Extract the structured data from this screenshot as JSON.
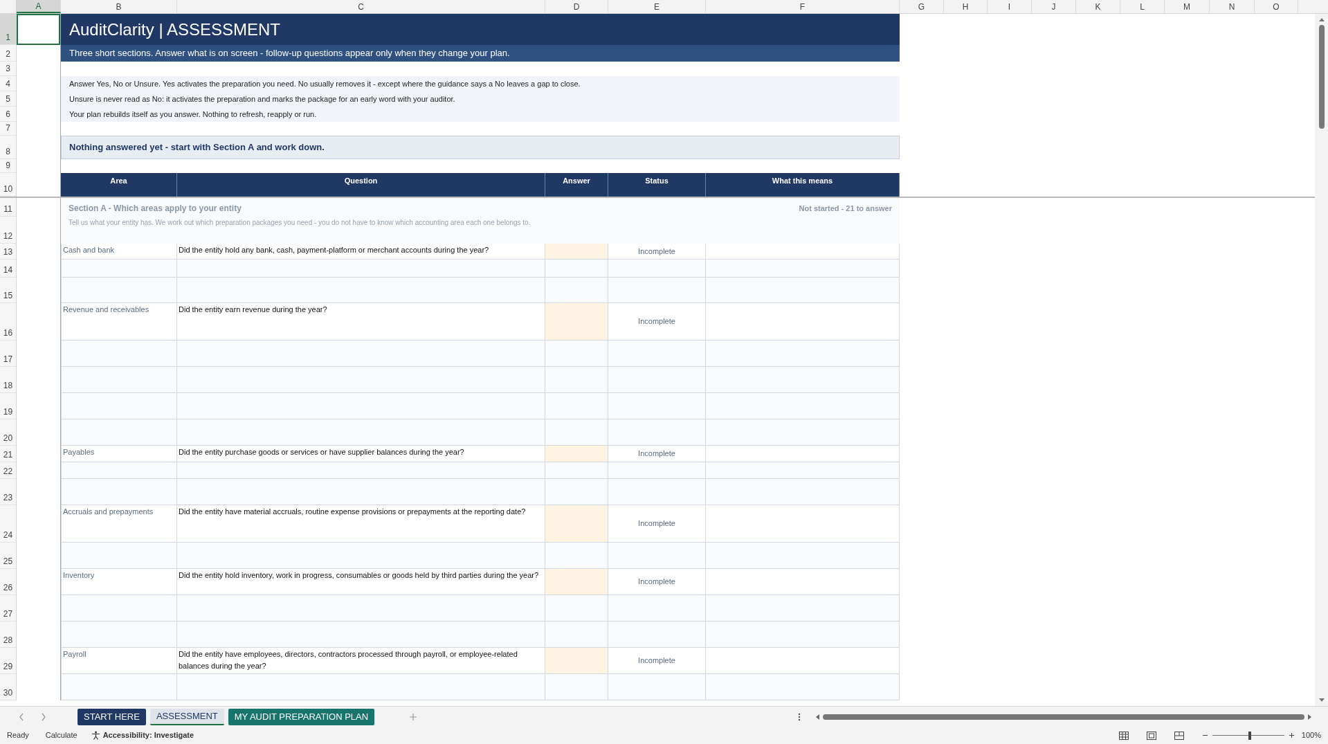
{
  "column_headers": [
    {
      "label": "A",
      "selected": true
    },
    {
      "label": "B",
      "selected": false
    },
    {
      "label": "C",
      "selected": false
    },
    {
      "label": "D",
      "selected": false
    },
    {
      "label": "E",
      "selected": false
    },
    {
      "label": "F",
      "selected": false
    },
    {
      "label": "G",
      "selected": false
    },
    {
      "label": "H",
      "selected": false
    },
    {
      "label": "I",
      "selected": false
    },
    {
      "label": "J",
      "selected": false
    },
    {
      "label": "K",
      "selected": false
    },
    {
      "label": "L",
      "selected": false
    },
    {
      "label": "M",
      "selected": false
    },
    {
      "label": "N",
      "selected": false
    },
    {
      "label": "O",
      "selected": false
    }
  ],
  "row_numbers": [
    {
      "label": "1",
      "selected": true
    },
    {
      "label": "2",
      "selected": false
    },
    {
      "label": "3",
      "selected": false
    },
    {
      "label": "4",
      "selected": false
    },
    {
      "label": "5",
      "selected": false
    },
    {
      "label": "6",
      "selected": false
    },
    {
      "label": "7",
      "selected": false
    },
    {
      "label": "8",
      "selected": false
    },
    {
      "label": "9",
      "selected": false
    },
    {
      "label": "10",
      "selected": false
    },
    {
      "label": "11",
      "selected": false
    },
    {
      "label": "12",
      "selected": false
    },
    {
      "label": "13",
      "selected": false
    },
    {
      "label": "14",
      "selected": false
    },
    {
      "label": "15",
      "selected": false
    },
    {
      "label": "16",
      "selected": false
    },
    {
      "label": "17",
      "selected": false
    },
    {
      "label": "18",
      "selected": false
    },
    {
      "label": "19",
      "selected": false
    },
    {
      "label": "20",
      "selected": false
    },
    {
      "label": "21",
      "selected": false
    },
    {
      "label": "22",
      "selected": false
    },
    {
      "label": "23",
      "selected": false
    },
    {
      "label": "24",
      "selected": false
    },
    {
      "label": "25",
      "selected": false
    },
    {
      "label": "26",
      "selected": false
    },
    {
      "label": "27",
      "selected": false
    },
    {
      "label": "28",
      "selected": false
    },
    {
      "label": "29",
      "selected": false
    },
    {
      "label": "30",
      "selected": false
    }
  ],
  "title": "AuditClarity | ASSESSMENT",
  "subtitle": "Three short sections. Answer what is on screen - follow-up questions appear only when they change your plan.",
  "instructions": [
    "Answer Yes, No or Unsure. Yes activates the preparation you need. No usually removes it - except where the guidance says a No leaves a gap to close.",
    "Unsure is never read as No: it activates the preparation and marks the package for an early word with your auditor.",
    "Your plan rebuilds itself as you answer. Nothing to refresh, reapply or run."
  ],
  "status_message": "Nothing answered yet - start with Section A and work down.",
  "table": {
    "columns": [
      "Area",
      "Question",
      "Answer",
      "Status",
      "What this means"
    ],
    "section": {
      "started": false,
      "title": "Section A - Which areas apply to your entity",
      "progress": "Not started - 21 to answer",
      "description": "Tell us what your entity has. We work out which preparation packages you need - you do not have to know which accounting area each one belongs to."
    },
    "rows": [
      {
        "kind": "question",
        "area": "Cash and bank",
        "question": "Did the entity hold any bank, cash, payment-platform or merchant accounts during the year?",
        "status": "Incomplete"
      },
      {
        "kind": "blank"
      },
      {
        "kind": "blank"
      },
      {
        "kind": "question",
        "area": "Revenue and receivables",
        "question": "Did the entity earn revenue during the year?",
        "status": "Incomplete"
      },
      {
        "kind": "blank"
      },
      {
        "kind": "blank"
      },
      {
        "kind": "blank"
      },
      {
        "kind": "blank"
      },
      {
        "kind": "question",
        "area": "Payables",
        "question": "Did the entity purchase goods or services or have supplier balances during the year?",
        "status": "Incomplete"
      },
      {
        "kind": "blank"
      },
      {
        "kind": "blank"
      },
      {
        "kind": "question",
        "area": "Accruals and prepayments",
        "question": "Did the entity have material accruals, routine expense provisions or prepayments at the reporting date?",
        "status": "Incomplete"
      },
      {
        "kind": "blank"
      },
      {
        "kind": "question",
        "area": "Inventory",
        "question": "Did the entity hold inventory, work in progress, consumables or goods held by third parties during the year?",
        "status": "Incomplete"
      },
      {
        "kind": "blank"
      },
      {
        "kind": "blank"
      },
      {
        "kind": "question",
        "area": "Payroll",
        "question": "Did the entity have employees, directors, contractors processed through payroll, or employee-related balances during the year?",
        "status": "Incomplete"
      },
      {
        "kind": "blank"
      }
    ]
  },
  "sheet_tabs": [
    {
      "label": "START HERE",
      "selected": false,
      "color": "#1f3864"
    },
    {
      "label": "ASSESSMENT",
      "selected": true,
      "color": "#1f3864"
    },
    {
      "label": "MY AUDIT PREPARATION PLAN",
      "selected": false,
      "color": "#17756b"
    }
  ],
  "status_bar": {
    "mode": "Ready",
    "calculate": "Calculate",
    "accessibility": "Accessibility: Investigate",
    "zoom": {
      "level": 0.5,
      "reading": "100%"
    }
  }
}
